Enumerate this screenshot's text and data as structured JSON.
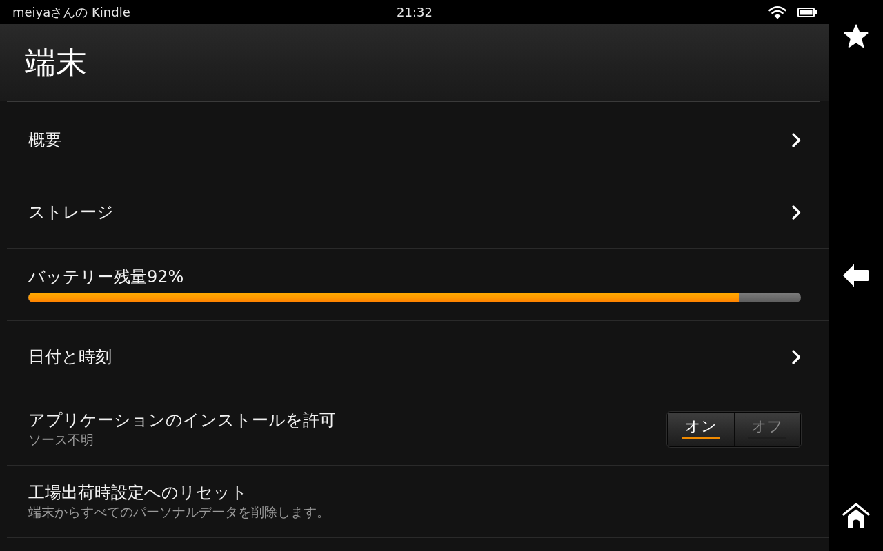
{
  "status_bar": {
    "device_name": "meiyaさんの Kindle",
    "time": "21:32"
  },
  "header": {
    "title": "端末"
  },
  "items": [
    {
      "kind": "link",
      "label": "概要"
    },
    {
      "kind": "link",
      "label": "ストレージ"
    },
    {
      "kind": "meter",
      "label": "バッテリー残量92%",
      "level": 0.92
    },
    {
      "kind": "link",
      "label": "日付と時刻"
    },
    {
      "kind": "toggle",
      "label": "アプリケーションのインストールを許可",
      "sublabel": "ソース不明",
      "options": [
        {
          "label": "オン",
          "selected": true
        },
        {
          "label": "オフ",
          "selected": false
        }
      ]
    },
    {
      "kind": "action",
      "label": "工場出荷時設定へのリセット",
      "sublabel": "端末からすべてのパーソナルデータを削除します。"
    }
  ]
}
